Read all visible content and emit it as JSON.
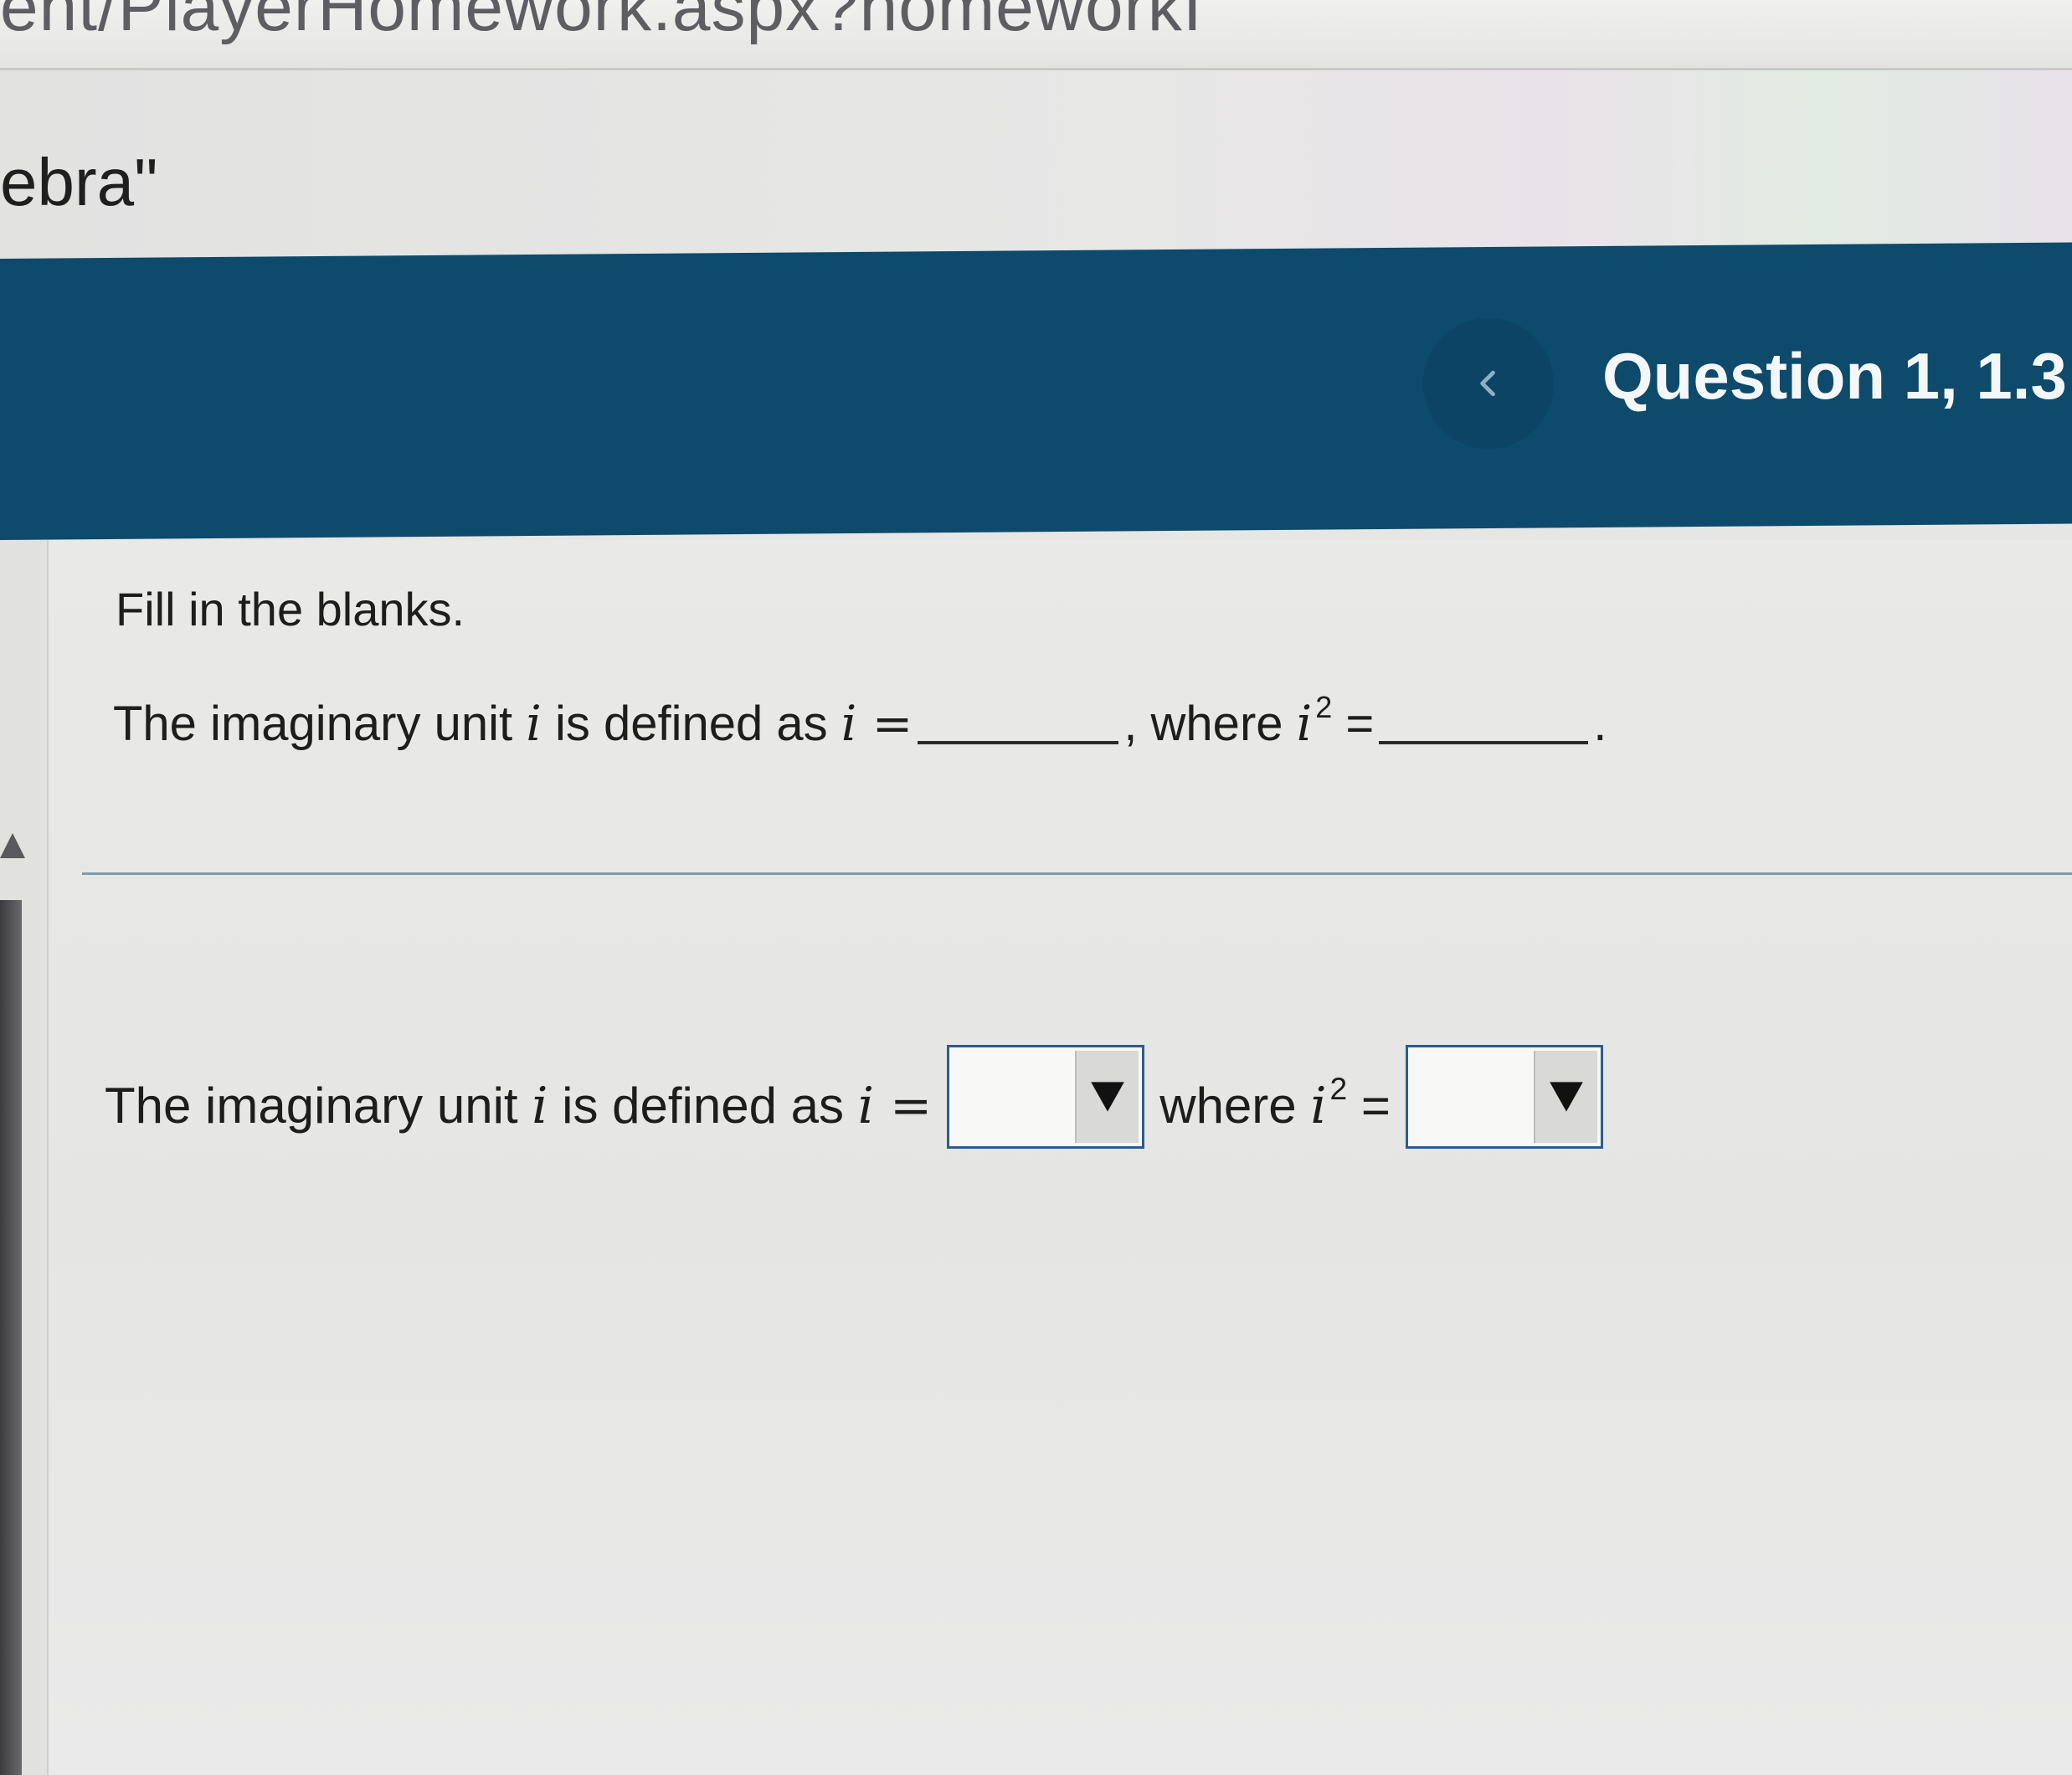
{
  "browser": {
    "url_fragment": "ent/PlayerHomework.aspx?homeworkI"
  },
  "tab": {
    "title_fragment": "ebra\""
  },
  "header": {
    "question_title": "Question 1, 1.3"
  },
  "question": {
    "instruction": "Fill in the blanks.",
    "statement": {
      "prefix": "The imaginary unit",
      "var_i": "i",
      "middle": "is defined as",
      "eq_i": "i =",
      "comma_where": ", where",
      "eq_i2_base": "i",
      "eq_i2_exp": "2",
      "eq_sign": "=",
      "end": "."
    },
    "answer": {
      "prefix": "The imaginary unit",
      "var_i": "i",
      "middle": "is defined as",
      "eq_i": "i =",
      "where": "where",
      "eq_i2_base": "i",
      "eq_i2_exp": "2",
      "eq_sign": "=",
      "dropdown1_value": "",
      "dropdown2_value": ""
    }
  },
  "colors": {
    "header_bg": "#0d4a6b",
    "dropdown_border": "#2c5c8f",
    "divider": "#7f9aaa"
  },
  "icons": {
    "back": "chevron-left-icon",
    "dropdown_arrow": "triangle-down-icon"
  }
}
